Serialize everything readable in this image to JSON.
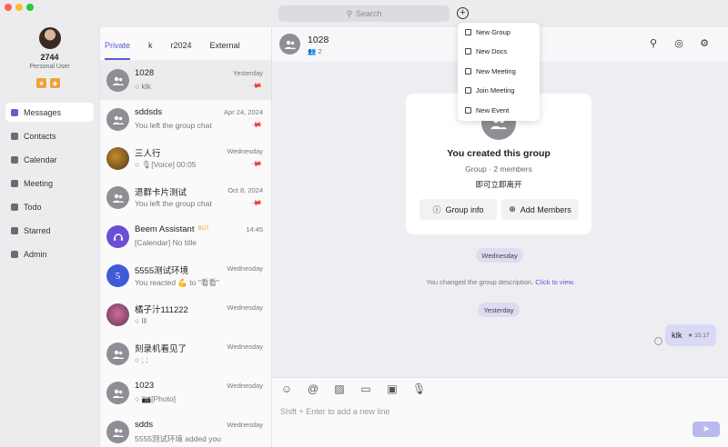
{
  "window": {
    "search_placeholder": "Search"
  },
  "profile": {
    "name": "2744",
    "subtitle": "Personal User"
  },
  "nav": [
    {
      "label": "Messages",
      "icon": "messages-icon",
      "active": true
    },
    {
      "label": "Contacts",
      "icon": "contacts-icon"
    },
    {
      "label": "Calendar",
      "icon": "calendar-icon"
    },
    {
      "label": "Meeting",
      "icon": "meeting-icon"
    },
    {
      "label": "Todo",
      "icon": "todo-icon"
    },
    {
      "label": "Starred",
      "icon": "star-icon"
    },
    {
      "label": "Admin",
      "icon": "admin-icon"
    }
  ],
  "tabs": [
    "Private",
    "k",
    "r2024",
    "External"
  ],
  "chats": [
    {
      "name": "1028",
      "time": "Yesterday",
      "msg": "○ klk",
      "pinned": true
    },
    {
      "name": "sddsds",
      "time": "Apr 24, 2024",
      "msg": "You left the group chat",
      "pinned": true
    },
    {
      "name": "三人行",
      "time": "Wednesday",
      "msg": "○ 🎙[Voice] 00:05",
      "pinned": true
    },
    {
      "name": "退群卡片测试",
      "time": "Oct 8, 2024",
      "msg": "You left the group chat",
      "pinned": true
    },
    {
      "name": "Beem Assistant",
      "tag": "BOT",
      "time": "14:45",
      "msg": "[Calendar] No title"
    },
    {
      "name": "5555测试环境",
      "time": "Wednesday",
      "msg": "You reacted 💪 to \"看看\""
    },
    {
      "name": "橘子汁111222",
      "time": "Wednesday",
      "msg": "○ lll"
    },
    {
      "name": "刻录机看见了",
      "time": "Wednesday",
      "msg": "○ ; ;"
    },
    {
      "name": "1023",
      "time": "Wednesday",
      "msg": "○ 📷[Photo]"
    },
    {
      "name": "sdds",
      "time": "Wednesday",
      "msg": "5555测试环境 added you"
    }
  ],
  "chat": {
    "title": "1028",
    "members_count": "2",
    "card": {
      "title": "You created this group",
      "subtitle": "Group · 2 members",
      "note": "即可立即离开",
      "group_info": "Group info",
      "add_members": "Add Members"
    },
    "day1": "Wednesday",
    "system_msg": "You changed the group description.",
    "system_link": "Click to view.",
    "day2": "Yesterday",
    "message_text": "klk",
    "message_time": "15:17",
    "composer_placeholder": "Shift + Enter to add a new line"
  },
  "dropdown": [
    "New Group",
    "New Docs",
    "New Meeting",
    "Join Meeting",
    "New Event"
  ],
  "colors": {
    "accent": "#5b5bd6",
    "bubble": "#d9d9f6",
    "pill": "#dddcf3"
  }
}
